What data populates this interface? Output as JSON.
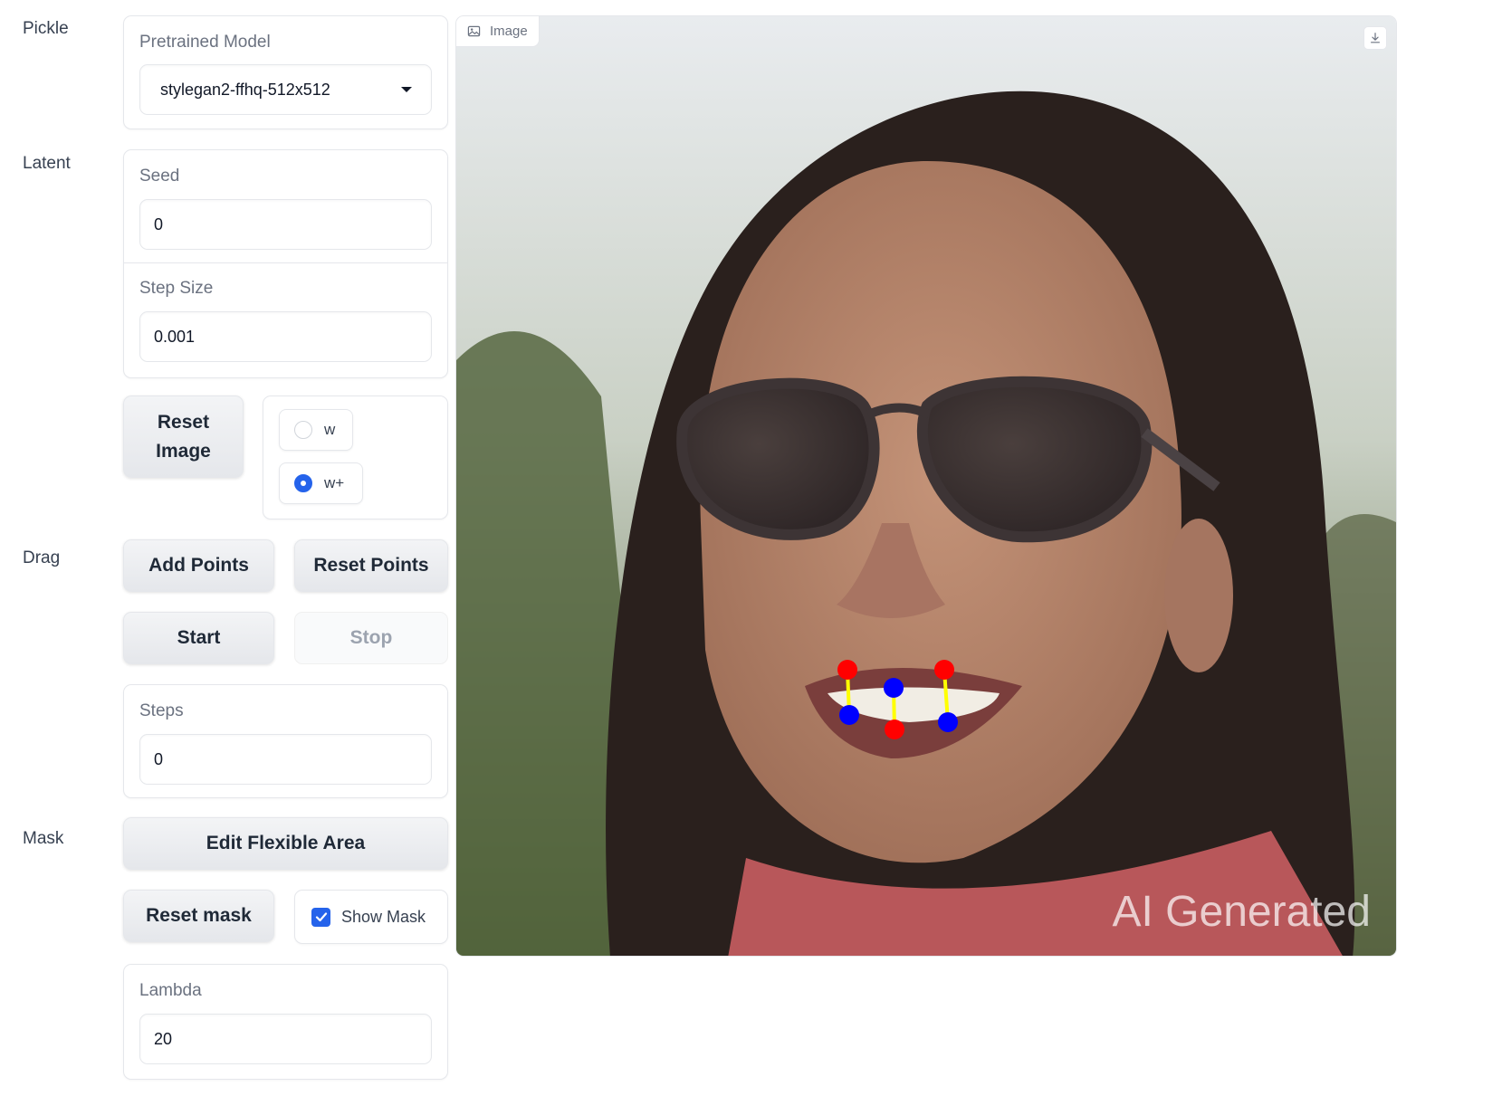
{
  "sections": {
    "pickle": "Pickle",
    "latent": "Latent",
    "drag": "Drag",
    "mask": "Mask"
  },
  "pretrained_model": {
    "label": "Pretrained Model",
    "value": "stylegan2-ffhq-512x512"
  },
  "seed": {
    "label": "Seed",
    "value": "0"
  },
  "step_size": {
    "label": "Step Size",
    "value": "0.001"
  },
  "reset_image": {
    "label": "Reset Image"
  },
  "latent_space": {
    "options": [
      "w",
      "w+"
    ],
    "selected": "w+"
  },
  "drag": {
    "add_points": "Add Points",
    "reset_points": "Reset Points",
    "start": "Start",
    "stop": "Stop"
  },
  "steps": {
    "label": "Steps",
    "value": "0"
  },
  "mask": {
    "edit_flexible_area": "Edit Flexible Area",
    "reset_mask": "Reset mask",
    "show_mask_label": "Show Mask",
    "show_mask_checked": true
  },
  "lambda": {
    "label": "Lambda",
    "value": "20"
  },
  "image": {
    "label": "Image",
    "watermark": "AI Generated",
    "icons": [
      "image-icon",
      "download-icon"
    ]
  },
  "colors": {
    "accent": "#2563eb",
    "handle_point": "#ff0000",
    "target_point": "#0000ff",
    "drag_line": "#ffff00"
  }
}
